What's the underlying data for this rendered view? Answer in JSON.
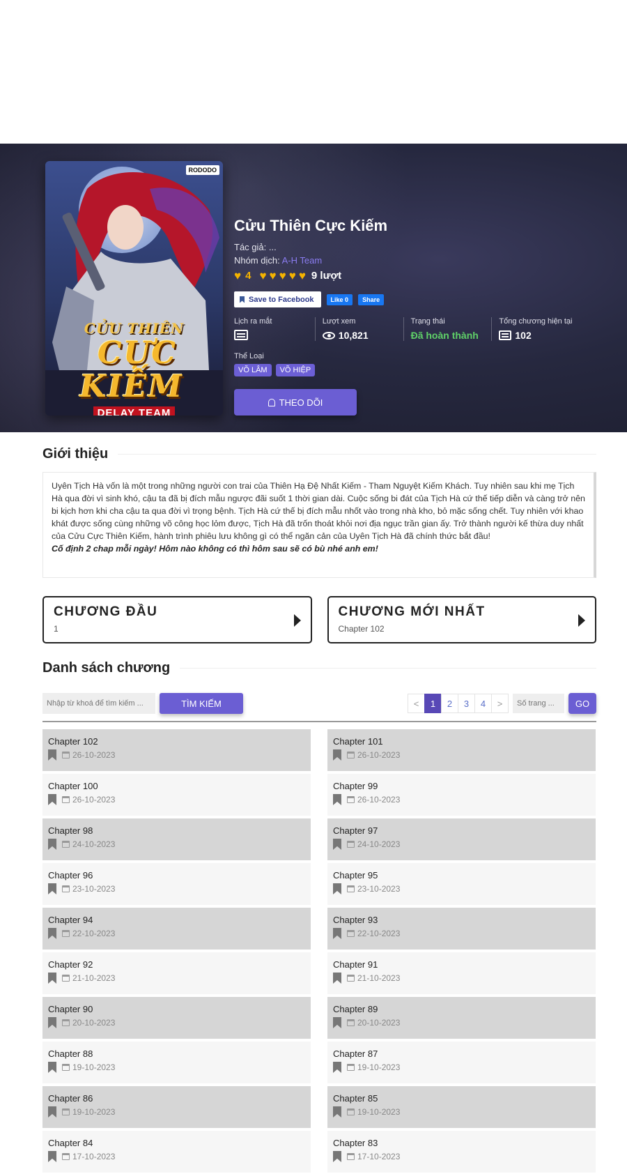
{
  "manga": {
    "title": "Cửu Thiên Cực Kiếm",
    "author": "Tác giả: ...",
    "group_label": "Nhóm dịch: ",
    "group_name": "A-H Team",
    "rating_value": "4",
    "rating_votes": "9 lượt",
    "cover": {
      "sub_title": "CỬU THIÊN",
      "main_title": "CỰC KIẾM",
      "team": "DELAY TEAM",
      "logo": "RODODO"
    }
  },
  "social": {
    "save_label": "Save to Facebook",
    "like_label": "Like 0",
    "share_label": "Share"
  },
  "stats": {
    "release_label": "Lịch ra mắt",
    "views_label": "Lượt xem",
    "views_value": "10,821",
    "status_label": "Trạng thái",
    "status_value": "Đã hoàn thành",
    "total_label": "Tổng chương hiện tại",
    "total_value": "102"
  },
  "genres": {
    "label": "Thể Loại",
    "items": [
      "VÕ LÂM",
      "VÕ HIỆP"
    ]
  },
  "follow_label": "THEO DÕI",
  "intro": {
    "title": "Giới thiệu",
    "text": "Uyên Tịch Hà vốn là một trong những người con trai của Thiên Hạ Đệ Nhất Kiếm - Tham Nguyệt Kiếm Khách. Tuy nhiên sau khi mẹ Tịch Hà qua đời vì sinh khó, cậu ta đã bị đích mẫu ngược đãi suốt 1 thời gian dài. Cuộc sống bi đát của Tịch Hà cứ thế tiếp diễn và càng trở nên bi kịch hơn khi cha cậu ta qua đời vì trọng bệnh. Tịch Hà cứ thế bị đích mẫu nhốt vào trong nhà kho, bỏ mặc sống chết. Tuy nhiên với khao khát được sống cùng những võ công học lỏm được, Tịch Hà đã trốn thoát khỏi nơi địa ngục trần gian ấy. Trở thành người kế thừa duy nhất của Cửu Cực Thiên Kiếm, hành trình phiêu lưu không gì có thể ngăn cản của Uyên Tịch Hà đã chính thức bắt đầu!",
    "note": "Cố định 2 chap mỗi ngày! Hôm nào không có thì hôm sau sẽ có bù nhé anh em!"
  },
  "first_chapter": {
    "title": "CHƯƠNG ĐẦU",
    "value": "1"
  },
  "latest_chapter": {
    "title": "CHƯƠNG MỚI NHẤT",
    "value": "Chapter 102"
  },
  "chapter_list": {
    "title": "Danh sách chương",
    "search_placeholder": "Nhập từ khoá để tìm kiếm ...",
    "search_button": "TÌM KIẾM",
    "pagination": [
      "<",
      "1",
      "2",
      "3",
      "4",
      ">"
    ],
    "page_placeholder": "Số trang ...",
    "go_button": "GO",
    "chapters": [
      {
        "name": "Chapter 102",
        "date": "26-10-2023"
      },
      {
        "name": "Chapter 101",
        "date": "26-10-2023"
      },
      {
        "name": "Chapter 100",
        "date": "26-10-2023"
      },
      {
        "name": "Chapter 99",
        "date": "26-10-2023"
      },
      {
        "name": "Chapter 98",
        "date": "24-10-2023"
      },
      {
        "name": "Chapter 97",
        "date": "24-10-2023"
      },
      {
        "name": "Chapter 96",
        "date": "23-10-2023"
      },
      {
        "name": "Chapter 95",
        "date": "23-10-2023"
      },
      {
        "name": "Chapter 94",
        "date": "22-10-2023"
      },
      {
        "name": "Chapter 93",
        "date": "22-10-2023"
      },
      {
        "name": "Chapter 92",
        "date": "21-10-2023"
      },
      {
        "name": "Chapter 91",
        "date": "21-10-2023"
      },
      {
        "name": "Chapter 90",
        "date": "20-10-2023"
      },
      {
        "name": "Chapter 89",
        "date": "20-10-2023"
      },
      {
        "name": "Chapter 88",
        "date": "19-10-2023"
      },
      {
        "name": "Chapter 87",
        "date": "19-10-2023"
      },
      {
        "name": "Chapter 86",
        "date": "19-10-2023"
      },
      {
        "name": "Chapter 85",
        "date": "19-10-2023"
      },
      {
        "name": "Chapter 84",
        "date": "17-10-2023"
      },
      {
        "name": "Chapter 83",
        "date": "17-10-2023"
      }
    ]
  },
  "colors": {
    "accent": "#6b5ed3",
    "status_done": "#5fd068",
    "heart": "#f5b300"
  },
  "icons": [
    "heart-icon",
    "bookmark-icon",
    "calendar-icon",
    "eye-icon",
    "list-icon",
    "bell-icon",
    "arrow-right-icon"
  ]
}
